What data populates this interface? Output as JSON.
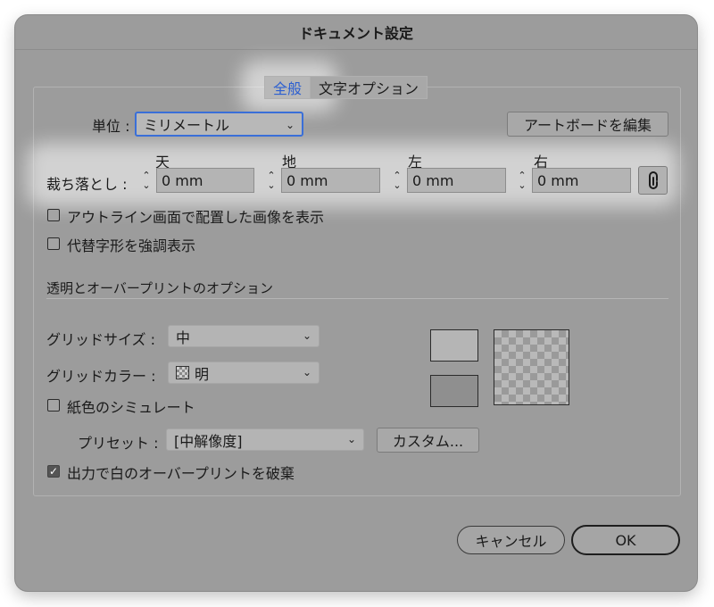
{
  "dialog": {
    "title": "ドキュメント設定"
  },
  "tabs": [
    {
      "label": "全般",
      "active": true
    },
    {
      "label": "文字オプション",
      "active": false
    }
  ],
  "units": {
    "label": "単位 :",
    "value": "ミリメートル"
  },
  "artboard_button": "アートボードを編集",
  "bleed": {
    "label": "裁ち落とし :",
    "top": {
      "label": "天",
      "value": "0 mm"
    },
    "bottom": {
      "label": "地",
      "value": "0 mm"
    },
    "left": {
      "label": "左",
      "value": "0 mm"
    },
    "right": {
      "label": "右",
      "value": "0 mm"
    },
    "link_icon": "link-icon"
  },
  "checkboxes": {
    "outline_images": {
      "label": "アウトライン画面で配置した画像を表示",
      "checked": false
    },
    "highlight_glyphs": {
      "label": "代替字形を強調表示",
      "checked": false
    }
  },
  "transparency": {
    "section_title": "透明とオーバープリントのオプション",
    "grid_size": {
      "label": "グリッドサイズ :",
      "value": "中"
    },
    "grid_color": {
      "label": "グリッドカラー :",
      "value": "明"
    },
    "simulate_paper": {
      "label": "紙色のシミュレート",
      "checked": false
    },
    "preset": {
      "label": "プリセット :",
      "value": "[中解像度]"
    },
    "custom_button": "カスタム...",
    "discard_overprint": {
      "label": "出力で白のオーバープリントを破棄",
      "checked": true
    },
    "swatch_light": "#b5b5b5",
    "swatch_dark": "#8f8f8f"
  },
  "footer": {
    "cancel": "キャンセル",
    "ok": "OK"
  }
}
